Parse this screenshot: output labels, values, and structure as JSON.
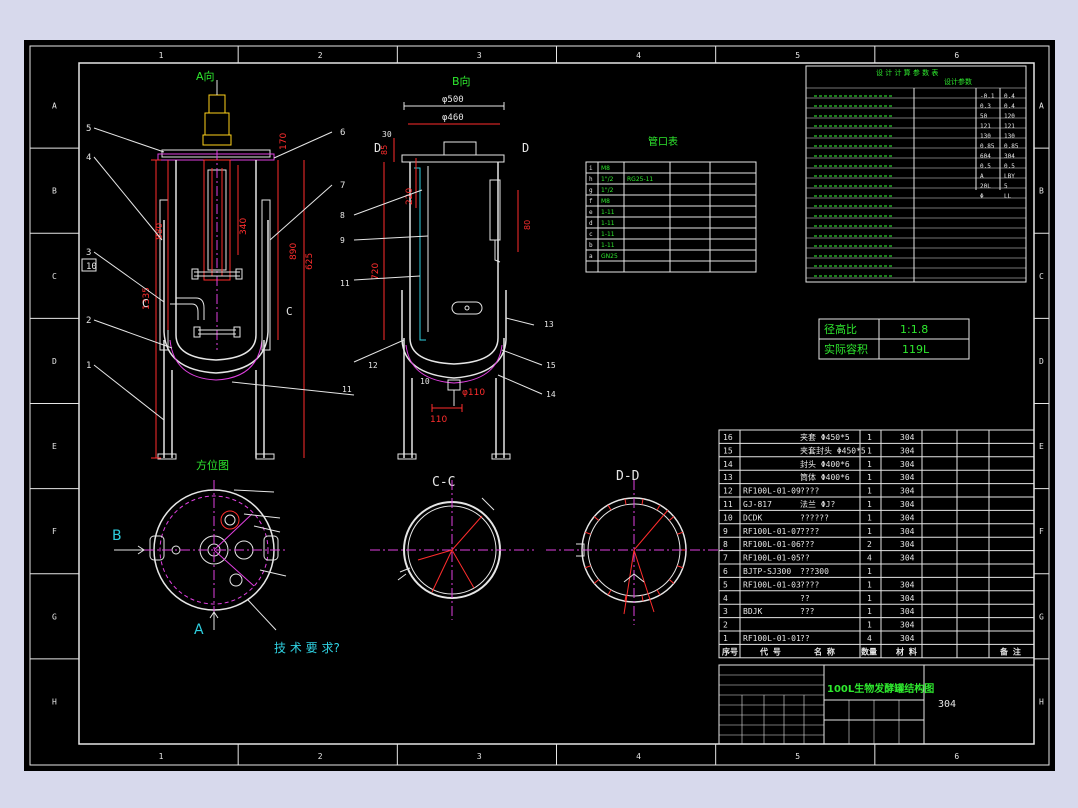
{
  "border": {
    "cols": [
      "1",
      "2",
      "3",
      "4",
      "5",
      "6"
    ],
    "rows": [
      "A",
      "B",
      "C",
      "D",
      "E",
      "F",
      "G",
      "H"
    ]
  },
  "views": {
    "front_label": "A向",
    "side_label": "B向",
    "orientation_label": "方位图",
    "section_cc": "C-C",
    "section_dd": "D-D",
    "arrow_a": "A",
    "arrow_b": "B",
    "cut_c": "C",
    "cut_d": "D",
    "tech_req": "技  术  要  求?"
  },
  "dims": {
    "d500": "φ500",
    "d460": "φ460",
    "d30": "30",
    "d85": "85",
    "d110": "110",
    "d1335": "1335",
    "d880": "880",
    "d340": "340",
    "d890": "890",
    "d625": "625",
    "d170": "170",
    "d720": "720",
    "d220": "220",
    "d80": "80",
    "dphi110": "φ110",
    "d110b": "110",
    "d10": "10"
  },
  "balloons_left": [
    "5",
    "4",
    "3",
    "10",
    "2",
    "1"
  ],
  "balloons_right_front": [
    "6",
    "7"
  ],
  "balloons_mid": [
    "8",
    "9",
    "11",
    "12",
    "11"
  ],
  "balloons_side": [
    "13",
    "15",
    "14"
  ],
  "nozzle_table": {
    "title": "管口表",
    "rows": [
      [
        "i",
        "M8",
        "",
        "",
        ""
      ],
      [
        "h",
        "1\"/2",
        "RG25-11",
        "",
        ""
      ],
      [
        "g",
        "1\"/2",
        "",
        "",
        ""
      ],
      [
        "f",
        "M8",
        "",
        "",
        ""
      ],
      [
        "e",
        "1-11",
        "",
        "",
        ""
      ],
      [
        "d",
        "1-11",
        "",
        "",
        ""
      ],
      [
        "c",
        "1-11",
        "",
        "",
        ""
      ],
      [
        "b",
        "1-11",
        "",
        "",
        ""
      ],
      [
        "a",
        "GN25",
        "",
        "",
        ""
      ],
      [
        "",
        "",
        "",
        "",
        ""
      ]
    ]
  },
  "spec_box": {
    "header1": "设 计 计 算 参 数 表",
    "header2": "设计参数",
    "ratio_label": "径高比",
    "ratio_value": "1:1.8",
    "volume_label": "实际容积",
    "volume_value": "119L",
    "values": [
      "-0.1",
      "0.4",
      "0.3",
      "0.4",
      "50",
      "120",
      "121",
      "121",
      "130",
      "130",
      "0.85",
      "0.85",
      "604",
      "304",
      "0.5",
      "0.5",
      "A",
      "LBY",
      "20L",
      "5",
      "Φ",
      "LL"
    ]
  },
  "bom": {
    "rows": [
      {
        "no": "16",
        "code": "",
        "name": "夹套 Φ450*5",
        "qty": "1",
        "mat": "304"
      },
      {
        "no": "15",
        "code": "",
        "name": "夹套封头 Φ450*5",
        "qty": "1",
        "mat": "304"
      },
      {
        "no": "14",
        "code": "",
        "name": "封头 Φ400*6",
        "qty": "1",
        "mat": "304"
      },
      {
        "no": "13",
        "code": "",
        "name": "筒体 Φ400*6",
        "qty": "1",
        "mat": "304"
      },
      {
        "no": "12",
        "code": "RF100L-01-09",
        "name": "????",
        "qty": "1",
        "mat": "304"
      },
      {
        "no": "11",
        "code": "GJ-817",
        "name": "法兰 ΦJ?",
        "qty": "1",
        "mat": "304"
      },
      {
        "no": "10",
        "code": "DCDK",
        "name": "??????",
        "qty": "1",
        "mat": "304"
      },
      {
        "no": "9",
        "code": "RF100L-01-07",
        "name": "????",
        "qty": "1",
        "mat": "304"
      },
      {
        "no": "8",
        "code": "RF100L-01-06",
        "name": "???",
        "qty": "2",
        "mat": "304"
      },
      {
        "no": "7",
        "code": "RF100L-01-05",
        "name": "??",
        "qty": "4",
        "mat": "304"
      },
      {
        "no": "6",
        "code": "BJTP-SJ300",
        "name": "???300",
        "qty": "1",
        "mat": ""
      },
      {
        "no": "5",
        "code": "RF100L-01-03",
        "name": "????",
        "qty": "1",
        "mat": "304"
      },
      {
        "no": "4",
        "code": "",
        "name": "??",
        "qty": "1",
        "mat": "304"
      },
      {
        "no": "3",
        "code": "BDJK",
        "name": "???",
        "qty": "1",
        "mat": "304"
      },
      {
        "no": "2",
        "code": "",
        "name": "",
        "qty": "1",
        "mat": "304"
      },
      {
        "no": "1",
        "code": "RF100L-01-01",
        "name": "??",
        "qty": "4",
        "mat": "304"
      }
    ],
    "header": [
      "序号",
      "代 号",
      "名 称",
      "数量",
      "材 料",
      "",
      "备 注"
    ]
  },
  "title_block": {
    "drawing_title": "100L生物发酵罐结构图",
    "material": "304"
  }
}
